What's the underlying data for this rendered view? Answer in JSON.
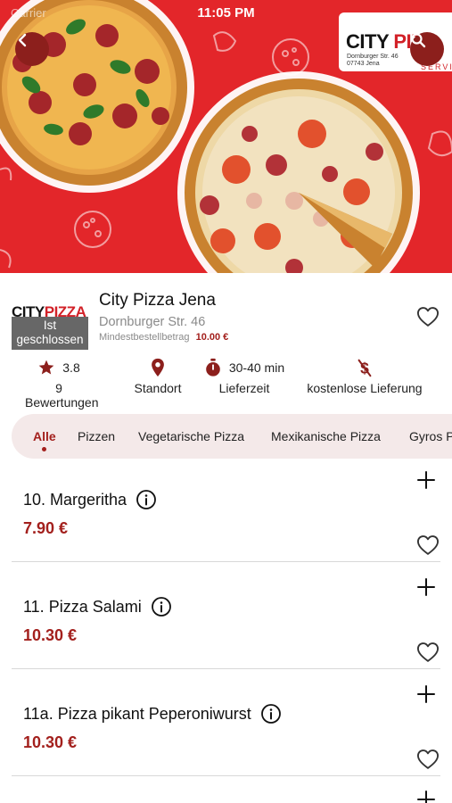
{
  "status_bar": {
    "carrier": "Carrier",
    "time": "11:05 PM"
  },
  "hero": {
    "brand_name_a": "CITY",
    "brand_name_b": "PIZ",
    "brand_address_line1": "Dornburger Str. 46",
    "brand_address_line2": "07743 Jena",
    "brand_sub": "SERVIC",
    "accent_color": "#e3262a"
  },
  "restaurant": {
    "logo_word_a": "CITY",
    "logo_word_b": "PIZZA",
    "status_line1": "Ist",
    "status_line2": "geschlossen",
    "name": "City Pizza Jena",
    "street": "Dornburger Str. 46",
    "min_order_label": "Mindestbestellbetrag",
    "min_order_value": "10.00 €"
  },
  "stats": {
    "rating": "3.8",
    "reviews": "9 Bewertungen",
    "location": "Standort",
    "delivery_time": "30-40 min",
    "delivery_time_label": "Lieferzeit",
    "delivery_fee_label": "kostenlose Lieferung"
  },
  "categories": [
    "Alle",
    "Pizzen",
    "Vegetarische Pizza",
    "Mexikanische Pizza",
    "Gyros P"
  ],
  "menu_items": [
    {
      "name": "10. Margeritha",
      "price": "7.90 €"
    },
    {
      "name": "11. Pizza Salami",
      "price": "10.30 €"
    },
    {
      "name": "11a. Pizza pikant Peperoniwurst",
      "price": "10.30 €"
    }
  ],
  "colors": {
    "brand_dark": "#8c1f1c",
    "price": "#a3201d",
    "tab_bg": "#f4e9e9"
  }
}
